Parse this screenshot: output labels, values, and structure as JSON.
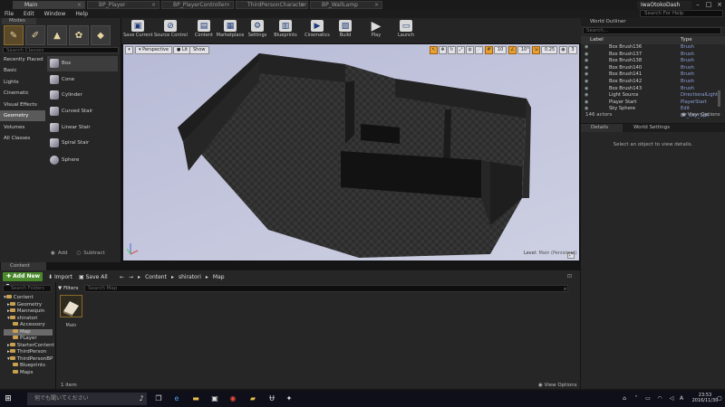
{
  "tabs": [
    {
      "label": "Main",
      "active": true
    },
    {
      "label": "BP_Player"
    },
    {
      "label": "BP_PlayerController"
    },
    {
      "label": "ThirdPersonCharacter"
    },
    {
      "label": "BP_WallLamp"
    }
  ],
  "window_user": "IwaOtokoDash",
  "menu": [
    "File",
    "Edit",
    "Window",
    "Help"
  ],
  "help_search_placeholder": "Search For Help",
  "modes": {
    "tab_label": "Modes",
    "search_placeholder": "Search Classes",
    "categories": [
      "Recently Placed",
      "Basic",
      "Lights",
      "Cinematic",
      "Visual Effects",
      "Geometry",
      "Volumes",
      "All Classes"
    ],
    "selected_category": "Geometry",
    "shapes": [
      "Box",
      "Cone",
      "Cylinder",
      "Curved Stair",
      "Linear Stair",
      "Spiral Stair",
      "Sphere"
    ],
    "add_label": "Add",
    "subtract_label": "Subtract"
  },
  "toolbar": [
    {
      "label": "Save Current",
      "icon": "save-icon"
    },
    {
      "label": "Source Control",
      "icon": "source-control-icon"
    },
    {
      "label": "Content",
      "icon": "content-icon"
    },
    {
      "label": "Marketplace",
      "icon": "marketplace-icon"
    },
    {
      "label": "Settings",
      "icon": "settings-icon"
    },
    {
      "label": "Blueprints",
      "icon": "blueprints-icon"
    },
    {
      "label": "Cinematics",
      "icon": "cinematics-icon"
    },
    {
      "label": "Build",
      "icon": "build-icon"
    },
    {
      "label": "Play",
      "icon": "play-icon"
    },
    {
      "label": "Launch",
      "icon": "launch-icon"
    }
  ],
  "viewport": {
    "perspective": "Perspective",
    "lit": "Lit",
    "show": "Show",
    "grid_snap": "10",
    "angle_snap": "10°",
    "scale_snap": "0.25",
    "camera_speed": "3",
    "level_label": "Level:",
    "level_name": "Main (Persistent)"
  },
  "outliner": {
    "title": "World Outliner",
    "search_placeholder": "Search...",
    "col_label": "Label",
    "col_type": "Type",
    "rows": [
      {
        "label": "Box Brush136",
        "type": "Brush"
      },
      {
        "label": "Box Brush137",
        "type": "Brush"
      },
      {
        "label": "Box Brush138",
        "type": "Brush"
      },
      {
        "label": "Box Brush140",
        "type": "Brush"
      },
      {
        "label": "Box Brush141",
        "type": "Brush"
      },
      {
        "label": "Box Brush142",
        "type": "Brush"
      },
      {
        "label": "Box Brush143",
        "type": "Brush"
      },
      {
        "label": "Light Source",
        "type": "DirectionalLight"
      },
      {
        "label": "Player Start",
        "type": "PlayerStart"
      },
      {
        "label": "Sky Sphere",
        "type": "Edit BP_Sky_Sph"
      }
    ],
    "count": "146 actors",
    "view_options": "View Options"
  },
  "details": {
    "tab_details": "Details",
    "tab_world": "World Settings",
    "empty_msg": "Select an object to view details."
  },
  "content_browser": {
    "tab": "Content Browser",
    "add_new": "Add New",
    "import": "Import",
    "save_all": "Save All",
    "path": [
      "Content",
      "shiratori",
      "Map"
    ],
    "search_folders": "Search Folders",
    "filters": "Filters",
    "search_placeholder": "Search Map",
    "folders": [
      {
        "label": "Content",
        "indent": 0
      },
      {
        "label": "Geometry",
        "indent": 1
      },
      {
        "label": "Mannequin",
        "indent": 1
      },
      {
        "label": "shiratori",
        "indent": 1
      },
      {
        "label": "Accessory",
        "indent": 2
      },
      {
        "label": "Map",
        "indent": 2,
        "selected": true
      },
      {
        "label": "PLayer",
        "indent": 2
      },
      {
        "label": "StarterContent",
        "indent": 1
      },
      {
        "label": "ThirdPerson",
        "indent": 1
      },
      {
        "label": "ThirdPersonBP",
        "indent": 1
      },
      {
        "label": "Blueprints",
        "indent": 2
      },
      {
        "label": "Maps",
        "indent": 2
      }
    ],
    "asset_name": "Main",
    "item_count": "1 item",
    "view_options": "View Options"
  },
  "taskbar": {
    "search_placeholder": "何でも聞いてください",
    "time": "23:53",
    "date": "2016/11/30"
  },
  "colors": {
    "accent": "#e8a030",
    "add_new": "#4a8a2c",
    "type_text": "#8fa0d8"
  }
}
